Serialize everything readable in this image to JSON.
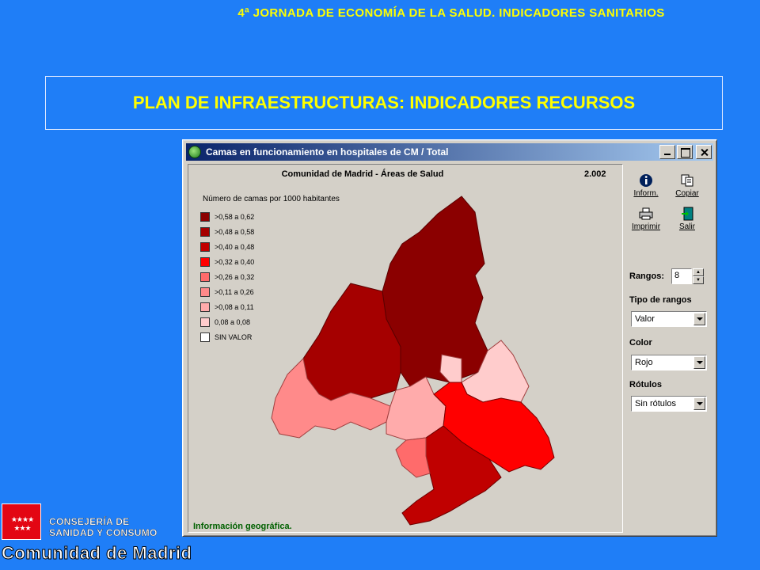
{
  "slide": {
    "header": "4ª JORNADA DE ECONOMÍA DE LA SALUD. INDICADORES SANITARIOS",
    "title": "PLAN DE INFRAESTRUCTURAS: INDICADORES RECURSOS"
  },
  "window": {
    "title": "Camas en funcionamiento en hospitales de CM / Total",
    "map_title": "Comunidad de Madrid - Áreas de Salud",
    "year": "2.002",
    "legend_title": "Número de camas por 1000 habitantes",
    "legend": [
      {
        "label": ">0,58 a 0,62",
        "color": "#8b0000"
      },
      {
        "label": ">0,48 a 0,58",
        "color": "#a50000"
      },
      {
        "label": ">0,40 a 0,48",
        "color": "#c00000"
      },
      {
        "label": ">0,32 a 0,40",
        "color": "#ff0000"
      },
      {
        "label": ">0,26 a 0,32",
        "color": "#ff6b6b"
      },
      {
        "label": ">0,11 a 0,26",
        "color": "#ff8a8a"
      },
      {
        "label": ">0,08 a 0,11",
        "color": "#ffabab"
      },
      {
        "label": "0,08 a 0,08",
        "color": "#ffcccc"
      },
      {
        "label": "SIN VALOR",
        "color": "#ffffff"
      }
    ],
    "status": "Información geográfica.",
    "toolbar": {
      "inform": "Inform.",
      "copiar": "Copiar",
      "imprimir": "Imprimir",
      "salir": "Salir"
    },
    "rangos_label": "Rangos:",
    "rangos_value": "8",
    "tipo_label": "Tipo de rangos",
    "tipo_value": "Valor",
    "color_label": "Color",
    "color_value": "Rojo",
    "rotulos_label": "Rótulos",
    "rotulos_value": "Sin rótulos"
  },
  "logo": {
    "org_line1": "CONSEJERÍA DE",
    "org_line2": "SANIDAD Y CONSUMO",
    "name": "Comunidad de Madrid"
  }
}
